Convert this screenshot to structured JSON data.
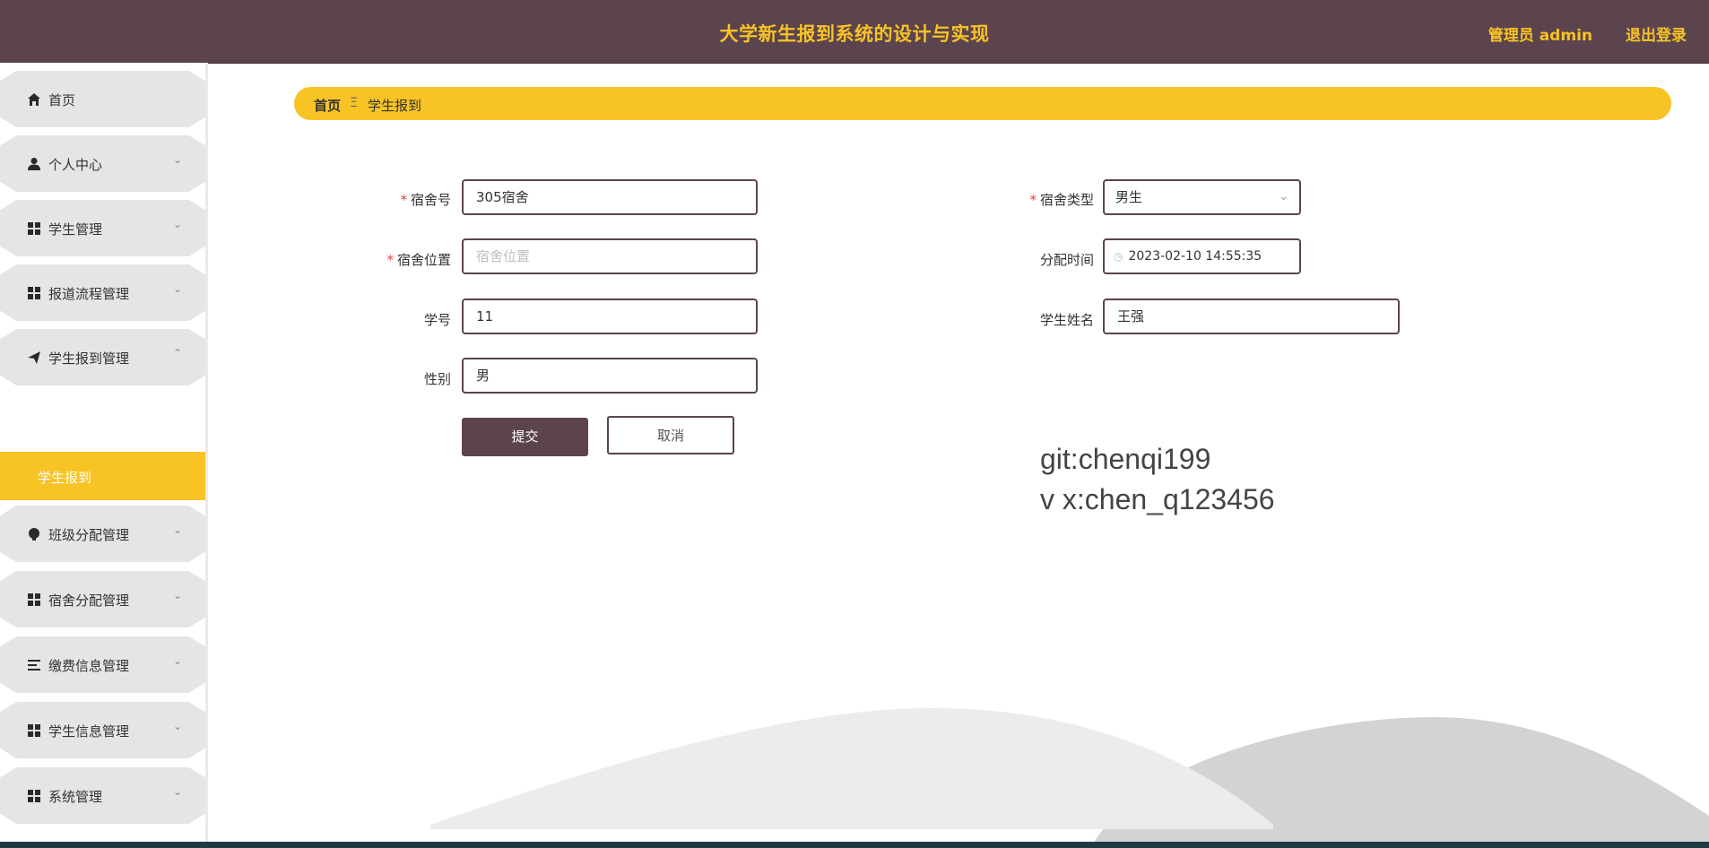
{
  "header": {
    "title": "大学新生报到系统的设计与实现",
    "admin_label": "管理员 admin",
    "logout_label": "退出登录"
  },
  "sidebar": {
    "items": [
      {
        "label": "首页",
        "icon": "home-icon",
        "expanded": false,
        "has_chevron": false
      },
      {
        "label": "个人中心",
        "icon": "user-icon",
        "expanded": false,
        "has_chevron": true
      },
      {
        "label": "学生管理",
        "icon": "grid-icon",
        "expanded": false,
        "has_chevron": true
      },
      {
        "label": "报道流程管理",
        "icon": "grid-icon",
        "expanded": false,
        "has_chevron": true
      },
      {
        "label": "学生报到管理",
        "icon": "send-icon",
        "expanded": true,
        "has_chevron": true
      },
      {
        "label": "班级分配管理",
        "icon": "bulb-icon",
        "expanded": false,
        "has_chevron": true
      },
      {
        "label": "宿舍分配管理",
        "icon": "grid-icon",
        "expanded": false,
        "has_chevron": true
      },
      {
        "label": "缴费信息管理",
        "icon": "list-icon",
        "expanded": false,
        "has_chevron": true
      },
      {
        "label": "学生信息管理",
        "icon": "grid-icon",
        "expanded": false,
        "has_chevron": true
      },
      {
        "label": "系统管理",
        "icon": "grid-icon",
        "expanded": false,
        "has_chevron": true
      }
    ],
    "active_sub": "学生报到"
  },
  "breadcrumb": {
    "home": "首页",
    "separator": "Ξ",
    "current": "学生报到"
  },
  "form": {
    "dorm_no": {
      "label": "宿舍号",
      "value": "305宿舍",
      "required": true
    },
    "dorm_type": {
      "label": "宿舍类型",
      "value": "男生",
      "required": true
    },
    "dorm_location": {
      "label": "宿舍位置",
      "value": "",
      "placeholder": "宿舍位置",
      "required": true
    },
    "assign_time": {
      "label": "分配时间",
      "value": "2023-02-10 14:55:35",
      "required": false
    },
    "student_no": {
      "label": "学号",
      "value": "11",
      "required": false
    },
    "student_name": {
      "label": "学生姓名",
      "value": "王强",
      "required": false
    },
    "gender": {
      "label": "性别",
      "value": "男",
      "required": false
    },
    "submit_label": "提交",
    "cancel_label": "取消"
  },
  "watermark": {
    "line1": "git:chenqi199",
    "line2": "v x:chen_q123456"
  },
  "colors": {
    "header_bg": "#5b444d",
    "accent": "#f7c325",
    "sidebar_item_bg": "#e5e5e5",
    "required": "#e04040"
  }
}
